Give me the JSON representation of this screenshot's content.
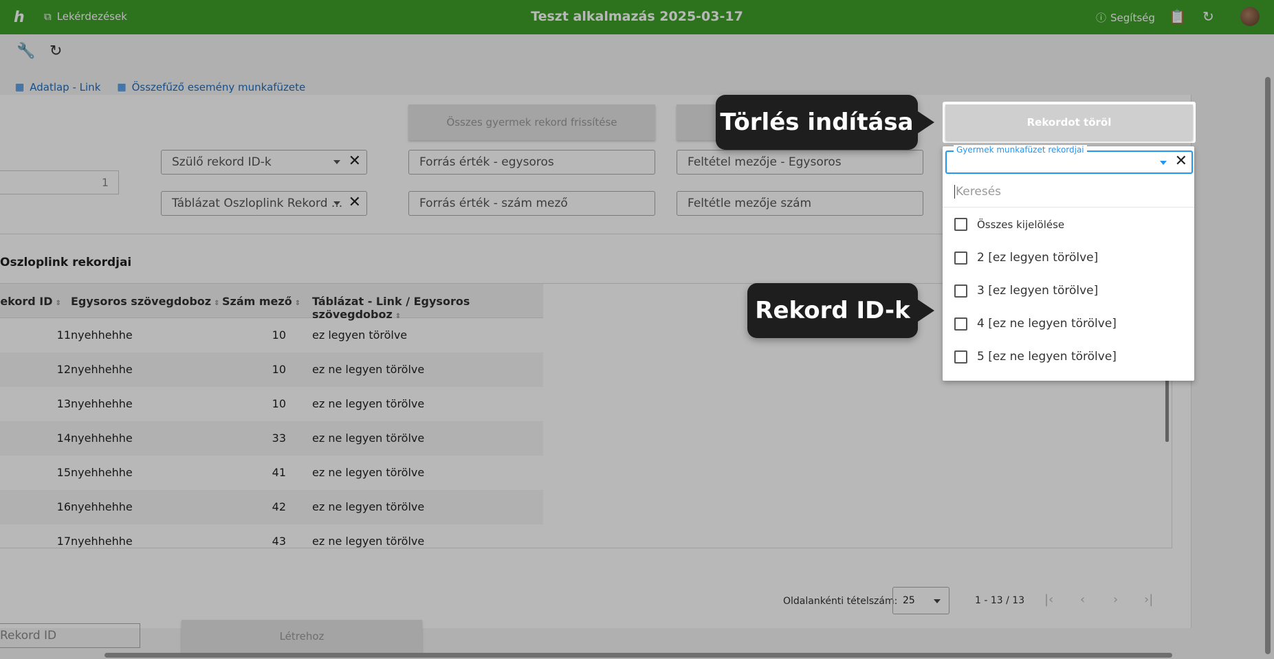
{
  "header": {
    "logo": "ℎ",
    "nav_label": "Lekérdezések",
    "title": "Teszt alkalmazás 2025-03-17",
    "help_label": "Segítség",
    "icons": [
      "clipboard-search-icon",
      "refresh-icon"
    ]
  },
  "toolbar": {
    "tools": [
      "wrench-icon",
      "refresh-icon"
    ]
  },
  "links": [
    {
      "label": "Adatlap - Link",
      "icon": "grid-icon"
    },
    {
      "label": "Összefűző esemény munkafüzete",
      "icon": "grid-icon"
    }
  ],
  "actions": {
    "refresh_children": "Összes gyermek rekord frissítése",
    "delete_record": "Rekordot töröl"
  },
  "fields": {
    "number_value": "1",
    "parent_ids": "Szülő rekord ID-k",
    "table_link_records": "Táblázat Oszloplink Rekord ...",
    "source_single": "Forrás érték - egysoros",
    "source_number": "Forrás érték - szám mező",
    "cond_single": "Feltétel mezője - Egysoros",
    "cond_number": "Feltétle mezője szám"
  },
  "section_title": "Oszloplink rekordjai",
  "table": {
    "columns": [
      "Rekord ID",
      "Egysoros szövegdoboz",
      "Szám mező",
      "Táblázat - Link / Egysoros szövegdoboz"
    ],
    "rows": [
      {
        "id": "11",
        "text": "nyehhehhe",
        "num": "10",
        "link": "ez legyen törölve"
      },
      {
        "id": "12",
        "text": "nyehhehhe",
        "num": "10",
        "link": "ez ne legyen törölve"
      },
      {
        "id": "13",
        "text": "nyehhehhe",
        "num": "10",
        "link": "ez ne legyen törölve"
      },
      {
        "id": "14",
        "text": "nyehhehhe",
        "num": "33",
        "link": "ez ne legyen törölve"
      },
      {
        "id": "15",
        "text": "nyehhehhe",
        "num": "41",
        "link": "ez ne legyen törölve"
      },
      {
        "id": "16",
        "text": "nyehhehhe",
        "num": "42",
        "link": "ez ne legyen törölve"
      },
      {
        "id": "17",
        "text": "nyehhehhe",
        "num": "43",
        "link": "ez ne legyen törölve"
      }
    ]
  },
  "pagination": {
    "per_page_label": "Oldalankénti tételszám:",
    "per_page_value": "25",
    "range": "1 - 13 / 13"
  },
  "bottom": {
    "record_id_placeholder": "Rekord ID",
    "create_button": "Létrehoz"
  },
  "dropdown": {
    "label": "Gyermek munkafüzet rekordjai",
    "search_placeholder": "Keresés",
    "select_all": "Összes kijelölése",
    "options": [
      "2 [ez legyen törölve]",
      "3 [ez legyen törölve]",
      "4 [ez ne legyen törölve]",
      "5 [ez ne legyen törölve]"
    ]
  },
  "callouts": {
    "delete": "Törlés indítása",
    "ids": "Rekord ID-k"
  }
}
